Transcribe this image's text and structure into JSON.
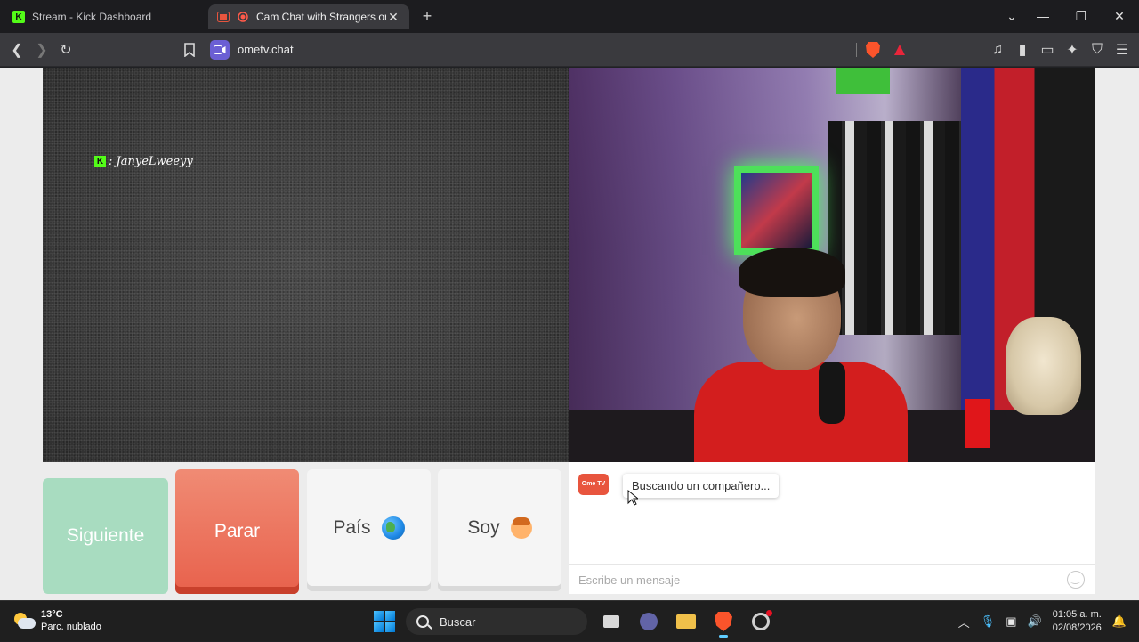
{
  "browser": {
    "tabs": [
      {
        "title": "Stream - Kick Dashboard",
        "active": false,
        "favicon": "kick-logo-icon"
      },
      {
        "title": "Cam Chat with Strangers on Ome",
        "active": true,
        "favicon": "recording-dot-icon"
      }
    ],
    "new_tab_label": "+",
    "url": "ometv.chat"
  },
  "video": {
    "kick_overlay_username": ": JanyeLweeyy"
  },
  "controls": {
    "next_label": "Siguiente",
    "stop_label": "Parar",
    "country_label": "País",
    "iam_label": "Soy"
  },
  "chat": {
    "logo_text": "Ome TV",
    "status_message": "Buscando un compañero...",
    "input_placeholder": "Escribe un mensaje"
  },
  "taskbar": {
    "weather_temp": "13°C",
    "weather_desc": "Parc. nublado",
    "search_label": "Buscar",
    "time": "01:05 a. m.",
    "date": "02/08/2026"
  },
  "colors": {
    "next_button": "#a8dcc0",
    "stop_button": "#e8614c",
    "kick_green": "#53fc18",
    "ome_red": "#e8553e"
  }
}
